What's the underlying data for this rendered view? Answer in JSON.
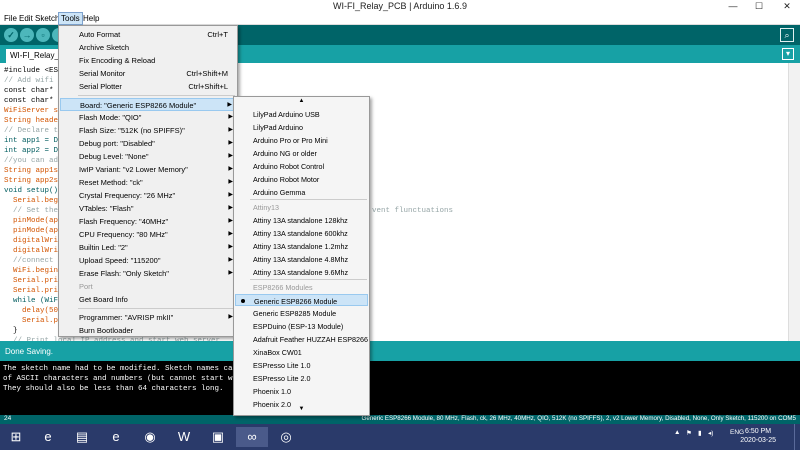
{
  "window": {
    "title": "WI-FI_Relay_PCB | Arduino 1.6.9",
    "minimize": "—",
    "maximize": "☐",
    "close": "✕"
  },
  "menubar": [
    "File",
    "Edit",
    "Sketch",
    "Tools",
    "Help"
  ],
  "toolbar": {
    "verify": "✓",
    "upload": "→",
    "new": "▫",
    "open": "↑",
    "save": "↓",
    "serial_monitor": "⌕"
  },
  "tab": {
    "label": "WI-FI_Relay_P",
    "dropdown": "▾"
  },
  "code": [
    "#include <ESP",
    "// Add wifi a",
    "const char* s",
    "const char* p",
    "WiFiServer se",
    "String header",
    "// Declare th",
    "int app1 = D1",
    "int app2 = D2",
    "//you can add",
    "String app1st",
    "String app2st",
    "void setup()",
    "  Serial.begi",
    "  // Set the p",
    "  pinMode(app",
    "  pinMode(app",
    "  digitalWrit",
    "  digitalWrit",
    "  //connect t",
    "  WiFi.begin(",
    "  Serial.prin",
    "  Serial.prin",
    "  while (WiFi",
    "    delay(500",
    "    Serial.pr",
    "  }",
    "  // Print local IP address and start web server"
  ],
  "code_fragment": "vent flunctuations",
  "console": {
    "header": "Done Saving.",
    "lines": [
      "The sketch name had to be modified. Sketch names can only",
      "of ASCII characters and numbers (but cannot start with a",
      "They should also be less than 64 characters long."
    ]
  },
  "status": {
    "line": "24",
    "board": "Generic ESP8266 Module, 80 MHz, Flash, ck, 26 MHz, 40MHz, QIO, 512K (no SPIFFS), 2, v2 Lower Memory, Disabled, None, Only Sketch, 115200 on COM5"
  },
  "tools_menu": {
    "items": [
      {
        "label": "Auto Format",
        "shortcut": "Ctrl+T"
      },
      {
        "label": "Archive Sketch"
      },
      {
        "label": "Fix Encoding & Reload"
      },
      {
        "label": "Serial Monitor",
        "shortcut": "Ctrl+Shift+M"
      },
      {
        "label": "Serial Plotter",
        "shortcut": "Ctrl+Shift+L"
      },
      {
        "label": "Board: \"Generic ESP8266 Module\""
      },
      {
        "label": "Flash Mode: \"QIO\""
      },
      {
        "label": "Flash Size: \"512K (no SPIFFS)\""
      },
      {
        "label": "Debug port: \"Disabled\""
      },
      {
        "label": "Debug Level: \"None\""
      },
      {
        "label": "IwIP Variant: \"v2 Lower Memory\""
      },
      {
        "label": "Reset Method: \"ck\""
      },
      {
        "label": "Crystal Frequency: \"26 MHz\""
      },
      {
        "label": "VTables: \"Flash\""
      },
      {
        "label": "Flash Frequency: \"40MHz\""
      },
      {
        "label": "CPU Frequency: \"80 MHz\""
      },
      {
        "label": "Builtin Led: \"2\""
      },
      {
        "label": "Upload Speed: \"115200\""
      },
      {
        "label": "Erase Flash: \"Only Sketch\""
      },
      {
        "label": "Port"
      },
      {
        "label": "Get Board Info"
      },
      {
        "label": "Programmer: \"AVRISP mkII\""
      },
      {
        "label": "Burn Bootloader"
      }
    ],
    "submenu_arrow": "▶"
  },
  "board_menu": {
    "scroll_up": "▲",
    "scroll_down": "▼",
    "items": [
      "LilyPad Arduino USB",
      "LilyPad Arduino",
      "Arduino Pro or Pro Mini",
      "Arduino NG or older",
      "Arduino Robot Control",
      "Arduino Robot Motor",
      "Arduino Gemma",
      "Attiny13",
      "Attiny 13A standalone 128khz",
      "Attiny 13A standalone 600khz",
      "Attiny 13A standalone 1.2mhz",
      "Attiny 13A standalone 4.8Mhz",
      "Attiny 13A standalone 9.6Mhz",
      "ESP8266 Modules",
      "Generic ESP8266 Module",
      "Generic ESP8285 Module",
      "ESPDuino (ESP-13 Module)",
      "Adafruit Feather HUZZAH ESP8266",
      "XinaBox CW01",
      "ESPresso Lite 1.0",
      "ESPresso Lite 2.0",
      "Phoenix 1.0",
      "Phoenix 2.0"
    ]
  },
  "taskbar": {
    "start": "⊞",
    "icons": [
      "e",
      "▤",
      "e",
      "◉",
      "W",
      "▣",
      "∞",
      "◎"
    ],
    "tray": [
      "▲",
      "⚑",
      "▮",
      "◂)",
      "ENG"
    ],
    "time": "6:50 PM",
    "date": "2020-03-25"
  }
}
